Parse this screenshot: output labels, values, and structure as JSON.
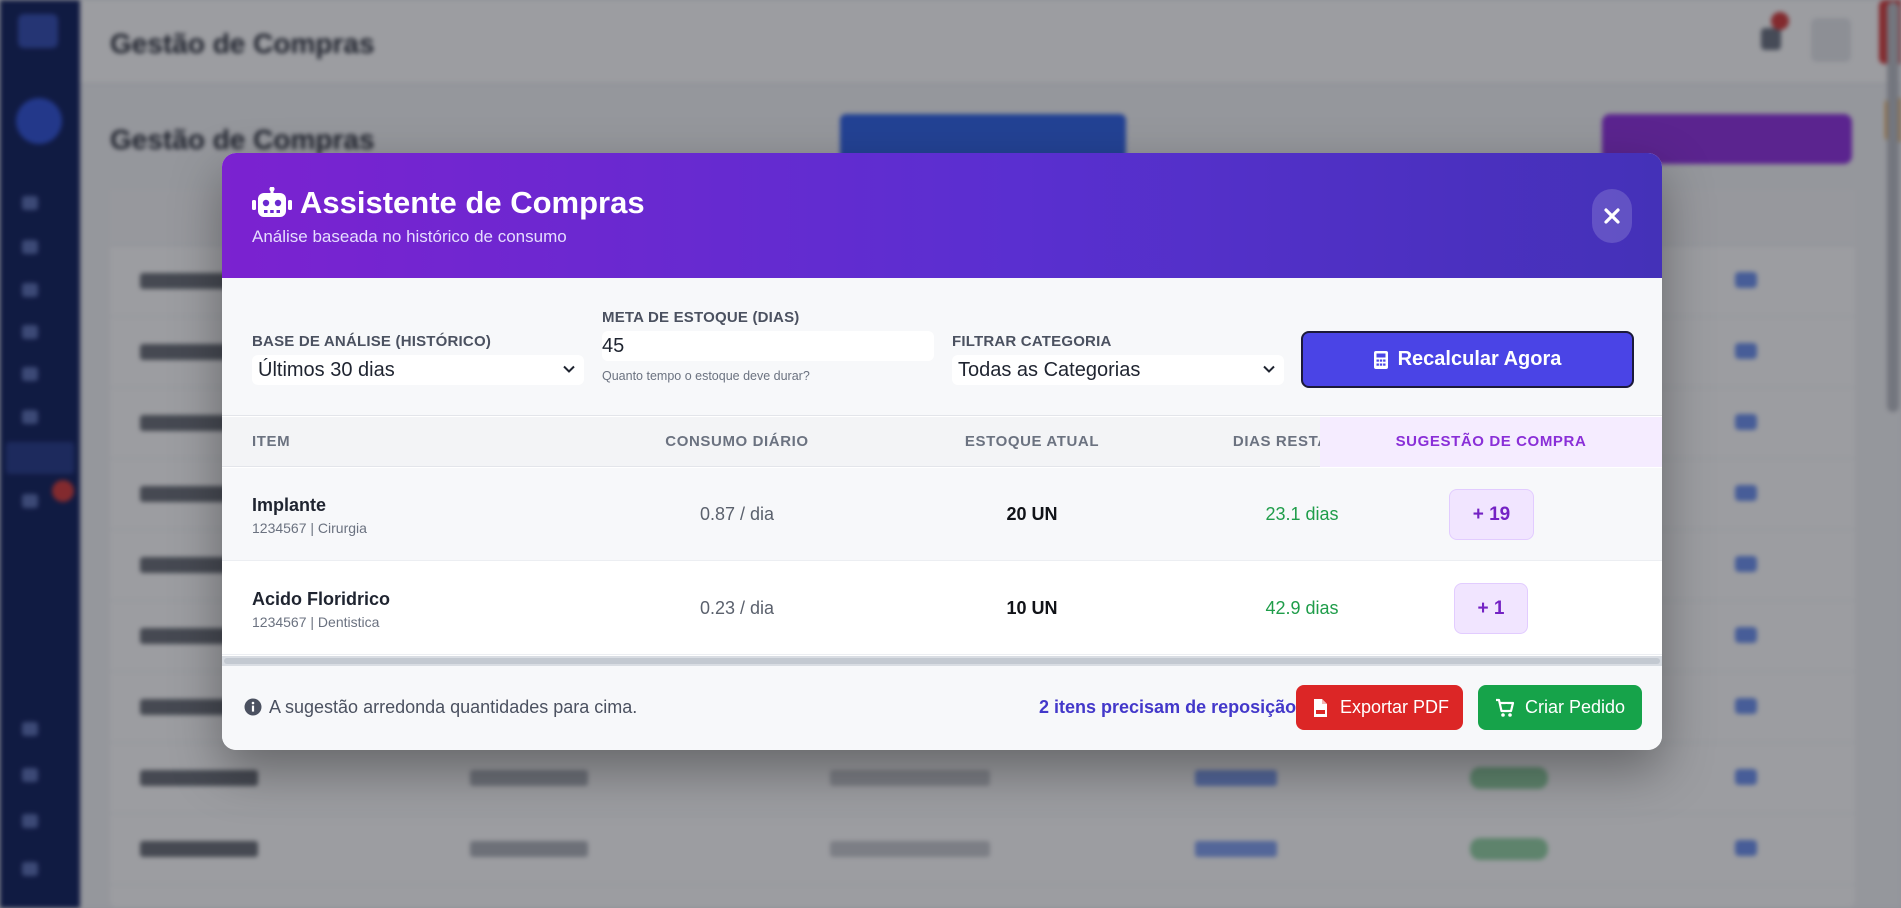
{
  "background": {
    "topbar_title": "Gestão de Compras",
    "page_title": "Gestão de Compras"
  },
  "modal": {
    "title": "Assistente de Compras",
    "subtitle": "Análise baseada no histórico de consumo",
    "close_icon": "close-icon",
    "header_icon": "robot-icon"
  },
  "controls": {
    "base_label": "Base de Análise (Histórico)",
    "base_value": "Últimos 30 dias",
    "meta_label": "Meta de Estoque (Dias)",
    "meta_value": "45",
    "meta_help": "Quanto tempo o estoque deve durar?",
    "categoria_label": "Filtrar Categoria",
    "categoria_value": "Todas as Categorias",
    "recalc_label": "Recalcular Agora",
    "recalc_icon": "calculator-icon"
  },
  "table": {
    "headers": {
      "item": "Item",
      "consumo": "Consumo Diário",
      "estoque": "Estoque Atual",
      "dias": "Dias Restantes",
      "sugestao": "Sugestão de Compra"
    },
    "rows": [
      {
        "name": "Implante",
        "meta": "1234567 | Cirurgia",
        "consumo": "0.87 / dia",
        "estoque": "20 UN",
        "dias": "23.1 dias",
        "sugestao": "+ 19"
      },
      {
        "name": "Acido Floridrico",
        "meta": "1234567 | Dentistica",
        "consumo": "0.23 / dia",
        "estoque": "10 UN",
        "dias": "42.9 dias",
        "sugestao": "+ 1"
      }
    ]
  },
  "footer": {
    "note": "A sugestão arredonda quantidades para cima.",
    "count": "2 itens precisam de reposição",
    "pdf_label": "Exportar PDF",
    "order_label": "Criar Pedido"
  },
  "colors": {
    "header_gradient_start": "#7b22d0",
    "header_gradient_end": "#4431b8",
    "primary": "#4a44e6",
    "success": "#16a34a",
    "danger": "#dc2626",
    "suggestion": "#7422c4"
  }
}
